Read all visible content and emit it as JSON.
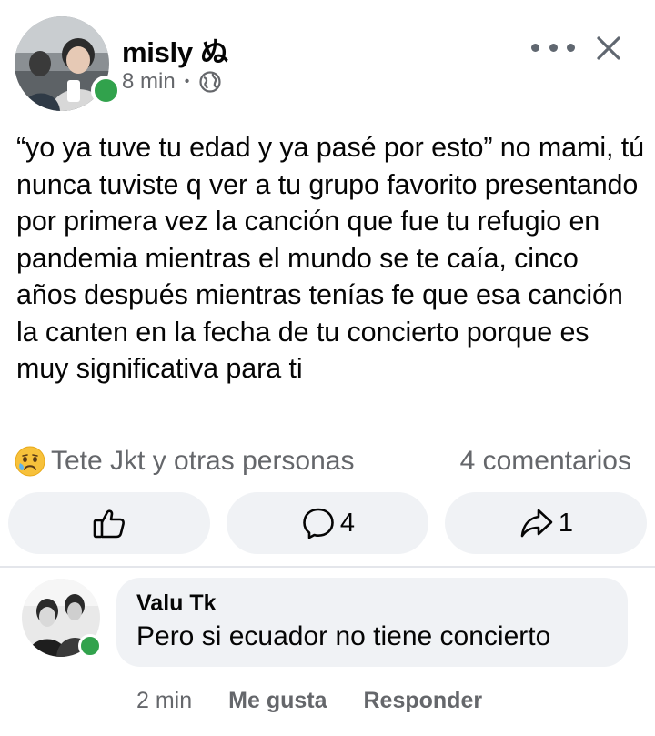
{
  "post": {
    "author": "misly ぬ",
    "time": "8 min",
    "separator": "•",
    "privacy_icon": "globe-icon",
    "text": "“yo ya tuve tu edad y ya pasé por esto” no mami, tú nunca tuviste q ver a tu grupo favorito presentando por primera vez la canción que fue tu refugio en pandemia mientras el mundo se te caía, cinco años después mientras tenías fe que esa canción la canten en la fecha de tu concierto porque es muy significativa para ti",
    "reaction_icon": "sad-face-icon",
    "reactions_text": "Tete Jkt y otras personas",
    "comments_text": "4 comentarios"
  },
  "actions": {
    "like_icon": "thumbs-up-icon",
    "comment_icon": "comment-bubble-icon",
    "comment_count": "4",
    "share_icon": "share-arrow-icon",
    "share_count": "1"
  },
  "comment": {
    "author": "Valu Tk",
    "text": "Pero si ecuador no tiene concierto",
    "time": "2 min",
    "like_label": "Me gusta",
    "reply_label": "Responder"
  },
  "colors": {
    "online": "#31a24c",
    "secondary_text": "#65676b",
    "button_bg": "#f0f2f5"
  }
}
